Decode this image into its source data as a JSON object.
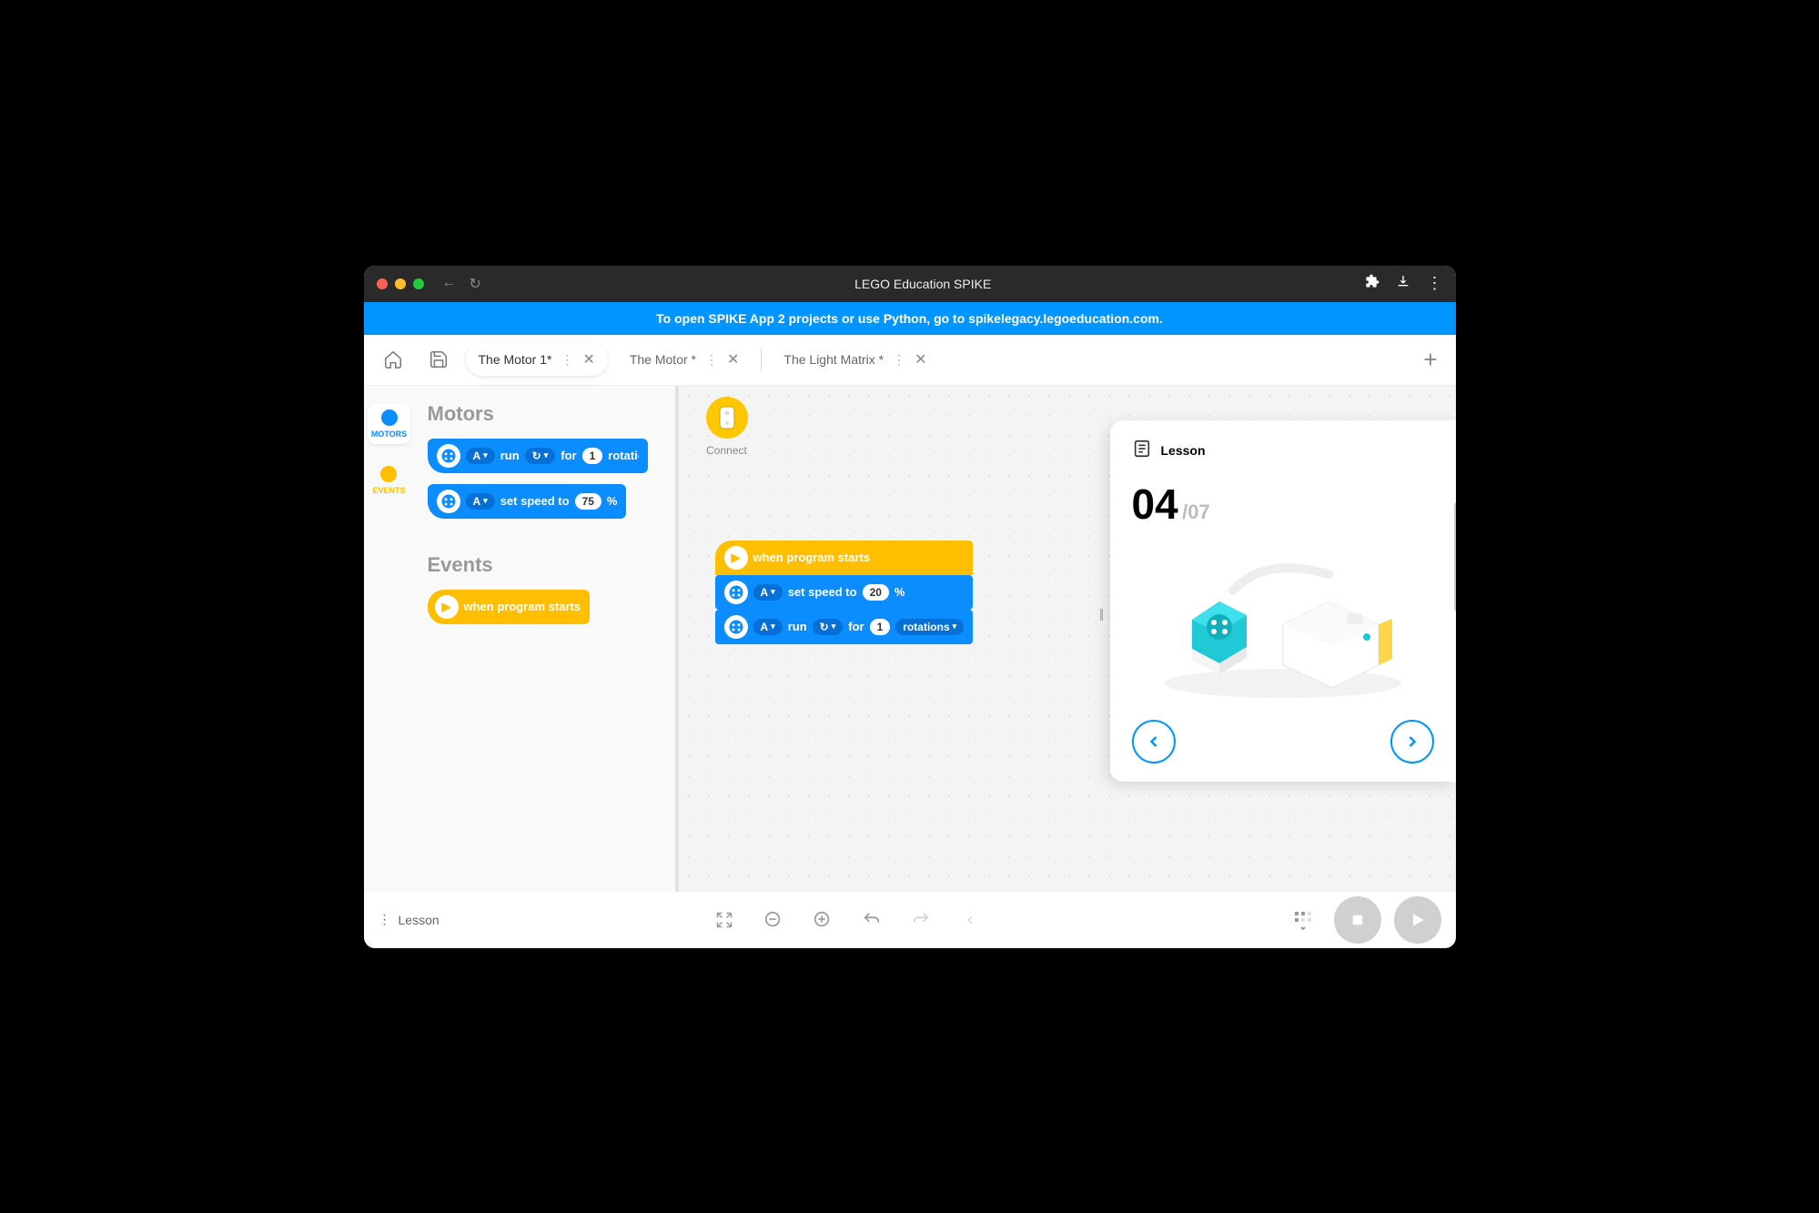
{
  "titlebar": {
    "title": "LEGO Education SPIKE"
  },
  "banner": {
    "text": "To open SPIKE App 2 projects or use Python, go to spikelegacy.legoeducation.com."
  },
  "tabs": [
    {
      "label": "The Motor 1*",
      "active": true
    },
    {
      "label": "The Motor *",
      "active": false
    },
    {
      "label": "The Light Matrix *",
      "active": false
    }
  ],
  "sidebar": {
    "categories": [
      {
        "name": "MOTORS",
        "color": "#0b8cff",
        "active": true
      },
      {
        "name": "EVENTS",
        "color": "#ffbf00",
        "active": false
      }
    ]
  },
  "palette": {
    "section1_title": "Motors",
    "block_run": {
      "port": "A",
      "verb": "run",
      "for_label": "for",
      "count": "1",
      "unit": "rotations"
    },
    "block_speed": {
      "port": "A",
      "verb": "set speed to",
      "value": "75",
      "unit": "%"
    },
    "section2_title": "Events",
    "block_start": {
      "label": "when program starts"
    }
  },
  "canvas": {
    "connect_label": "Connect",
    "stack": {
      "start_label": "when program starts",
      "speed": {
        "port": "A",
        "verb": "set speed to",
        "value": "20",
        "unit": "%"
      },
      "run": {
        "port": "A",
        "verb": "run",
        "for_label": "for",
        "count": "1",
        "unit": "rotations"
      }
    }
  },
  "lesson": {
    "heading": "Lesson",
    "step": "04",
    "total": "/07"
  },
  "footer": {
    "lesson_label": "Lesson"
  }
}
